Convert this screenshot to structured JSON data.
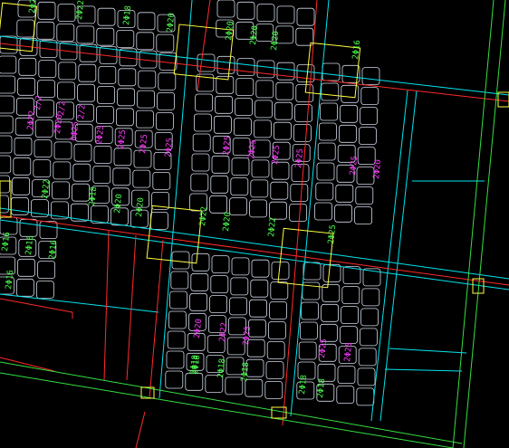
{
  "colors": {
    "background": "#000000",
    "grid_cells": "#cfd6e6",
    "cyan": "#00e5ee",
    "red": "#ff2a2a",
    "green": "#35e040",
    "yellow": "#ffff40",
    "magenta": "#ff3cff",
    "green_text": "#4dff4d"
  },
  "green_labels": [
    "2Φ25",
    "2Φ22",
    "2Φ18",
    "2Φ20",
    "2Φ20",
    "2Φ20",
    "2Φ20",
    "2Φ16",
    "2Φ22",
    "2Φ18",
    "2Φ20",
    "2Φ20",
    "2Φ22",
    "2Φ20",
    "2Φ22",
    "2Φ25",
    "2Φ16",
    "2Φ16",
    "2Φ16",
    "2Φ16",
    "2Φ18",
    "2Φ18",
    "2Φ18",
    "2Φ18",
    "2Φ18",
    "2Φ18"
  ],
  "magenta_labels": [
    "2Φ22",
    "2/2",
    "2Φ20",
    "2/2",
    "6Φ25",
    "2/2",
    "2Φ25",
    "2Φ25",
    "2Φ25",
    "2Φ25",
    "2Φ25",
    "2Φ25",
    "2Φ25",
    "2Φ25",
    "2Φ25",
    "2Φ20",
    "2Φ20",
    "2Φ22",
    "2Φ25",
    "2Φ25",
    "2Φ25"
  ]
}
